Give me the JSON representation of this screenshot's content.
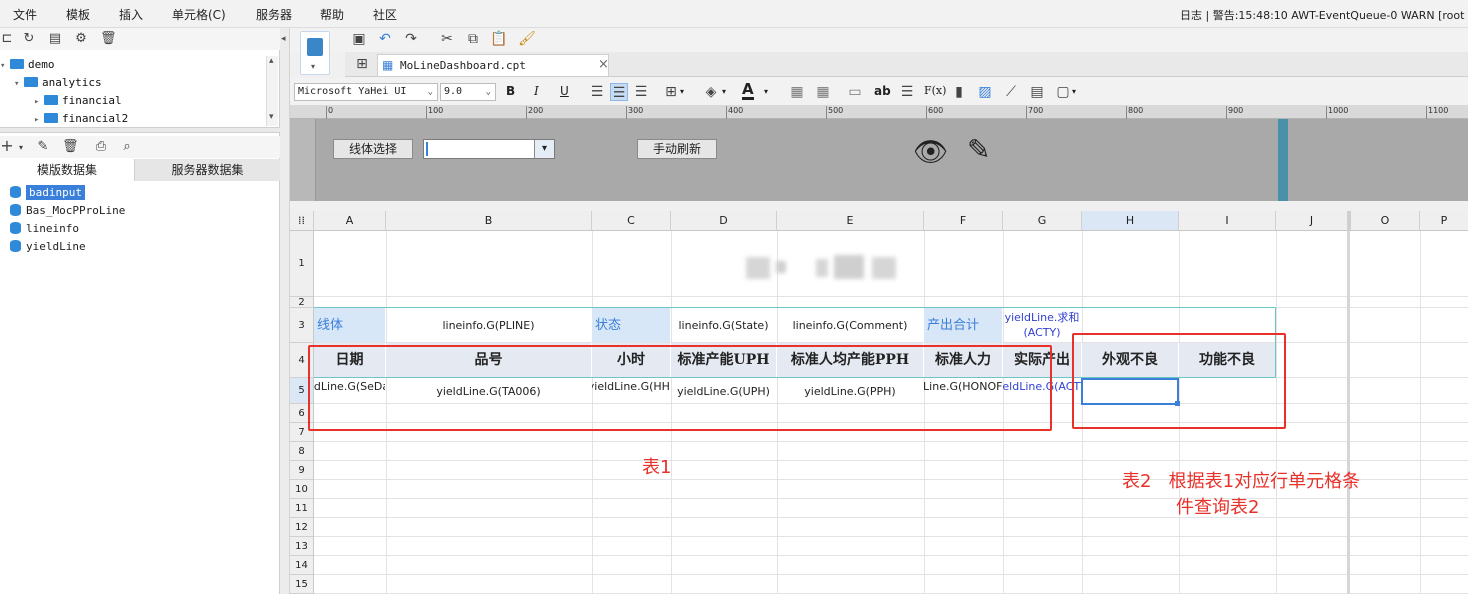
{
  "menubar": {
    "items": [
      "文件",
      "模板",
      "插入",
      "单元格(C)",
      "服务器",
      "帮助",
      "社区"
    ],
    "log": "日志 | 警告:15:48:10 AWT-EventQueue-0 WARN [root"
  },
  "tree": {
    "items": [
      {
        "label": "demo",
        "expanded": true
      },
      {
        "label": "analytics",
        "expanded": true
      },
      {
        "label": "financial",
        "expanded": false
      },
      {
        "label": "financial2",
        "expanded": false
      }
    ]
  },
  "datasets": {
    "tab_template": "模版数据集",
    "tab_server": "服务器数据集",
    "items": [
      "badinput",
      "Bas_MocPProLine",
      "lineinfo",
      "yieldLine"
    ],
    "selected": "badinput"
  },
  "file_tab": {
    "name": "MoLineDashboard.cpt"
  },
  "format": {
    "font": "Microsoft YaHei UI",
    "size": "9.0",
    "bold": "B",
    "italic": "I",
    "underline": "U",
    "text_tool": "ab",
    "fx_tool": "F(x)"
  },
  "ruler": {
    "ticks": [
      "0",
      "100",
      "200",
      "300",
      "400",
      "500",
      "600",
      "700",
      "800",
      "900",
      "1000",
      "1100"
    ]
  },
  "params": {
    "line_select_label": "线体选择",
    "line_select_value": "",
    "refresh_button": "手动刷新"
  },
  "grid": {
    "columns": [
      "A",
      "B",
      "C",
      "D",
      "E",
      "F",
      "G",
      "H",
      "I",
      "J",
      "O",
      "P"
    ],
    "rows": [
      "1",
      "2",
      "3",
      "4",
      "5",
      "6",
      "7",
      "8",
      "9",
      "10",
      "11",
      "12",
      "13",
      "14",
      "15"
    ],
    "r3": {
      "a": "线体",
      "b": "lineinfo.G(PLINE)",
      "c": "状态",
      "d": "lineinfo.G(State)",
      "e": "lineinfo.G(Comment)",
      "f": "产出合计",
      "g": "yieldLine.求和(ACTY)"
    },
    "r4": {
      "a": "日期",
      "b": "品号",
      "c": "小时",
      "d": "标准产能UPH",
      "e": "标准人均产能PPH",
      "f": "标准人力",
      "g": "实际产出",
      "h": "外观不良",
      "i": "功能不良"
    },
    "r5": {
      "a": "yieldLine.G(SeDate)",
      "b": "yieldLine.G(TA006)",
      "c": "yieldLine.G(HH)",
      "d": "yieldLine.G(UPH)",
      "e": "yieldLine.G(PPH)",
      "f": "yieldLine.G(HONOFFUN)",
      "g": "yieldLine.G(ACTY)"
    }
  },
  "annotations": {
    "table1": "表1",
    "table2_line1": "表2   根据表1对应行单元格条",
    "table2_line2": "件查询表2"
  },
  "colors": {
    "accent_blue": "#2e8ad8",
    "header_blue": "#d8e7f7",
    "annotation_red": "#e8312a"
  }
}
